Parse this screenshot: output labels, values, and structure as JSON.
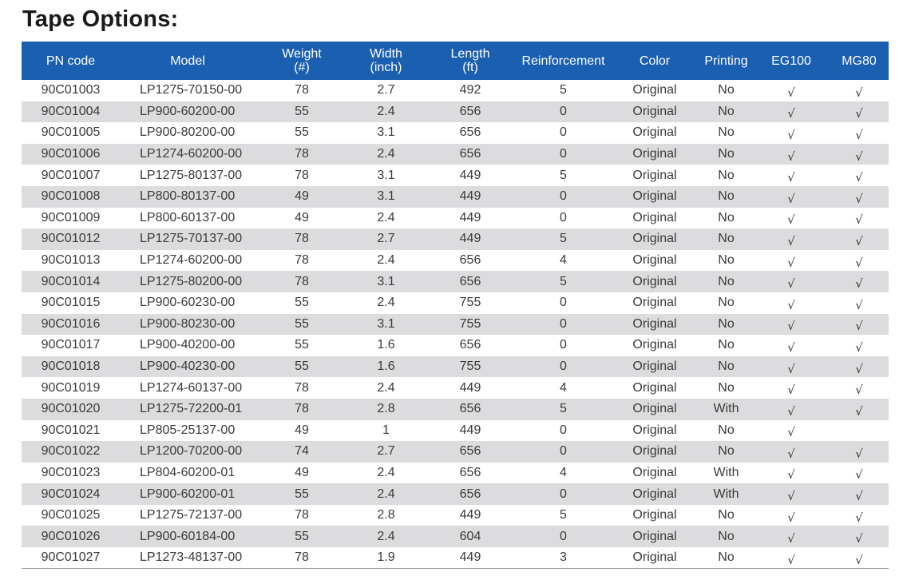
{
  "title": "Tape Options:",
  "columns": [
    {
      "key": "pn",
      "line1": "PN code",
      "line2": ""
    },
    {
      "key": "model",
      "line1": "Model",
      "line2": ""
    },
    {
      "key": "weight",
      "line1": "Weight",
      "line2": "(#)"
    },
    {
      "key": "width",
      "line1": "Width",
      "line2": "(inch)"
    },
    {
      "key": "length",
      "line1": "Length",
      "line2": "(ft)"
    },
    {
      "key": "reinforcement",
      "line1": "Reinforcement",
      "line2": ""
    },
    {
      "key": "color",
      "line1": "Color",
      "line2": ""
    },
    {
      "key": "printing",
      "line1": "Printing",
      "line2": ""
    },
    {
      "key": "eg100",
      "line1": "EG100",
      "line2": ""
    },
    {
      "key": "mg80",
      "line1": "MG80",
      "line2": ""
    }
  ],
  "rows": [
    {
      "pn": "90C01003",
      "model": "LP1275-70150-00",
      "weight": "78",
      "width": "2.7",
      "length": "492",
      "reinforcement": "5",
      "color": "Original",
      "printing": "No",
      "eg100": "√",
      "mg80": "√"
    },
    {
      "pn": "90C01004",
      "model": "LP900-60200-00",
      "weight": "55",
      "width": "2.4",
      "length": "656",
      "reinforcement": "0",
      "color": "Original",
      "printing": "No",
      "eg100": "√",
      "mg80": "√"
    },
    {
      "pn": "90C01005",
      "model": "LP900-80200-00",
      "weight": "55",
      "width": "3.1",
      "length": "656",
      "reinforcement": "0",
      "color": "Original",
      "printing": "No",
      "eg100": "√",
      "mg80": "√"
    },
    {
      "pn": "90C01006",
      "model": "LP1274-60200-00",
      "weight": "78",
      "width": "2.4",
      "length": "656",
      "reinforcement": "0",
      "color": "Original",
      "printing": "No",
      "eg100": "√",
      "mg80": "√"
    },
    {
      "pn": "90C01007",
      "model": "LP1275-80137-00",
      "weight": "78",
      "width": "3.1",
      "length": "449",
      "reinforcement": "5",
      "color": "Original",
      "printing": "No",
      "eg100": "√",
      "mg80": "√"
    },
    {
      "pn": "90C01008",
      "model": "LP800-80137-00",
      "weight": "49",
      "width": "3.1",
      "length": "449",
      "reinforcement": "0",
      "color": "Original",
      "printing": "No",
      "eg100": "√",
      "mg80": "√"
    },
    {
      "pn": "90C01009",
      "model": "LP800-60137-00",
      "weight": "49",
      "width": "2.4",
      "length": "449",
      "reinforcement": "0",
      "color": "Original",
      "printing": "No",
      "eg100": "√",
      "mg80": "√"
    },
    {
      "pn": "90C01012",
      "model": "LP1275-70137-00",
      "weight": "78",
      "width": "2.7",
      "length": "449",
      "reinforcement": "5",
      "color": "Original",
      "printing": "No",
      "eg100": "√",
      "mg80": "√"
    },
    {
      "pn": "90C01013",
      "model": "LP1274-60200-00",
      "weight": "78",
      "width": "2.4",
      "length": "656",
      "reinforcement": "4",
      "color": "Original",
      "printing": "No",
      "eg100": "√",
      "mg80": "√"
    },
    {
      "pn": "90C01014",
      "model": "LP1275-80200-00",
      "weight": "78",
      "width": "3.1",
      "length": "656",
      "reinforcement": "5",
      "color": "Original",
      "printing": "No",
      "eg100": "√",
      "mg80": "√"
    },
    {
      "pn": "90C01015",
      "model": "LP900-60230-00",
      "weight": "55",
      "width": "2.4",
      "length": "755",
      "reinforcement": "0",
      "color": "Original",
      "printing": "No",
      "eg100": "√",
      "mg80": "√"
    },
    {
      "pn": "90C01016",
      "model": "LP900-80230-00",
      "weight": "55",
      "width": "3.1",
      "length": "755",
      "reinforcement": "0",
      "color": "Original",
      "printing": "No",
      "eg100": "√",
      "mg80": "√"
    },
    {
      "pn": "90C01017",
      "model": "LP900-40200-00",
      "weight": "55",
      "width": "1.6",
      "length": "656",
      "reinforcement": "0",
      "color": "Original",
      "printing": "No",
      "eg100": "√",
      "mg80": "√"
    },
    {
      "pn": "90C01018",
      "model": "LP900-40230-00",
      "weight": "55",
      "width": "1.6",
      "length": "755",
      "reinforcement": "0",
      "color": "Original",
      "printing": "No",
      "eg100": "√",
      "mg80": "√"
    },
    {
      "pn": "90C01019",
      "model": "LP1274-60137-00",
      "weight": "78",
      "width": "2.4",
      "length": "449",
      "reinforcement": "4",
      "color": "Original",
      "printing": "No",
      "eg100": "√",
      "mg80": "√"
    },
    {
      "pn": "90C01020",
      "model": "LP1275-72200-01",
      "weight": "78",
      "width": "2.8",
      "length": "656",
      "reinforcement": "5",
      "color": "Original",
      "printing": "With",
      "eg100": "√",
      "mg80": "√"
    },
    {
      "pn": "90C01021",
      "model": "LP805-25137-00",
      "weight": "49",
      "width": "1",
      "length": "449",
      "reinforcement": "0",
      "color": "Original",
      "printing": "No",
      "eg100": "√",
      "mg80": ""
    },
    {
      "pn": "90C01022",
      "model": "LP1200-70200-00",
      "weight": "74",
      "width": "2.7",
      "length": "656",
      "reinforcement": "0",
      "color": "Original",
      "printing": "No",
      "eg100": "√",
      "mg80": "√"
    },
    {
      "pn": "90C01023",
      "model": "LP804-60200-01",
      "weight": "49",
      "width": "2.4",
      "length": "656",
      "reinforcement": "4",
      "color": "Original",
      "printing": "With",
      "eg100": "√",
      "mg80": "√"
    },
    {
      "pn": "90C01024",
      "model": "LP900-60200-01",
      "weight": "55",
      "width": "2.4",
      "length": "656",
      "reinforcement": "0",
      "color": "Original",
      "printing": "With",
      "eg100": "√",
      "mg80": "√"
    },
    {
      "pn": "90C01025",
      "model": "LP1275-72137-00",
      "weight": "78",
      "width": "2.8",
      "length": "449",
      "reinforcement": "5",
      "color": "Original",
      "printing": "No",
      "eg100": "√",
      "mg80": "√"
    },
    {
      "pn": "90C01026",
      "model": "LP900-60184-00",
      "weight": "55",
      "width": "2.4",
      "length": "604",
      "reinforcement": "0",
      "color": "Original",
      "printing": "No",
      "eg100": "√",
      "mg80": "√"
    },
    {
      "pn": "90C01027",
      "model": "LP1273-48137-00",
      "weight": "78",
      "width": "1.9",
      "length": "449",
      "reinforcement": "3",
      "color": "Original",
      "printing": "No",
      "eg100": "√",
      "mg80": "√"
    }
  ],
  "colors": {
    "header_bg": "#1a5fb0",
    "header_text": "#ffffff",
    "stripe_bg": "#dcdcde",
    "body_text": "#3a3a3a"
  }
}
